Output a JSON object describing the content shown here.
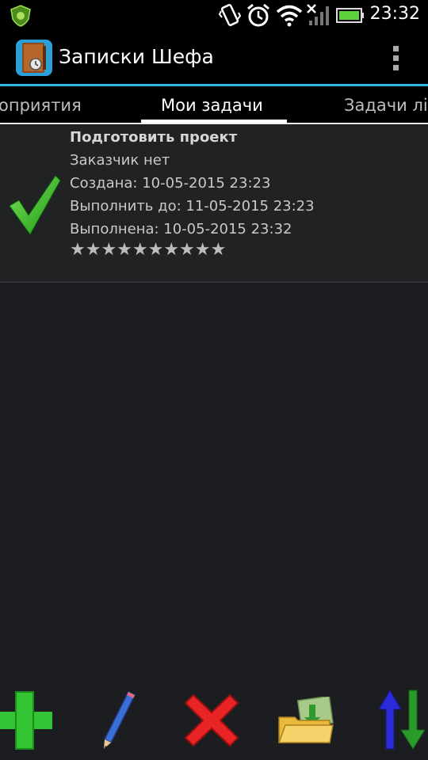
{
  "status_bar": {
    "time": "23:32",
    "icons": [
      "shield-icon",
      "vibrate-icon",
      "alarm-icon",
      "wifi-icon",
      "no-signal-icon",
      "battery-icon"
    ]
  },
  "action_bar": {
    "title": "Записки Шефа",
    "menu_icon": "overflow-menu-icon"
  },
  "tabs": [
    {
      "label": "оприятия",
      "active": false
    },
    {
      "label": "Мои задачи",
      "active": true
    },
    {
      "label": "Задачи лі",
      "active": false
    }
  ],
  "task": {
    "title": "Подготовить проект",
    "customer": "Заказчик  нет",
    "created": "Создана:  10-05-2015 23:23",
    "due": "Выполнить до:  11-05-2015 23:23",
    "done": "Выполнена:  10-05-2015 23:32",
    "rating": "★★★★★★★★★★",
    "rating_value": 0,
    "rating_max": 10,
    "status_icon": "checkmark-icon"
  },
  "toolbar": {
    "buttons": [
      "add-icon",
      "edit-icon",
      "delete-icon",
      "open-folder-icon",
      "sort-icon"
    ]
  },
  "colors": {
    "accent": "#33b5e5",
    "check_green": "#3dbf2e",
    "add_green": "#2fbf2f",
    "delete_red": "#e02020"
  }
}
